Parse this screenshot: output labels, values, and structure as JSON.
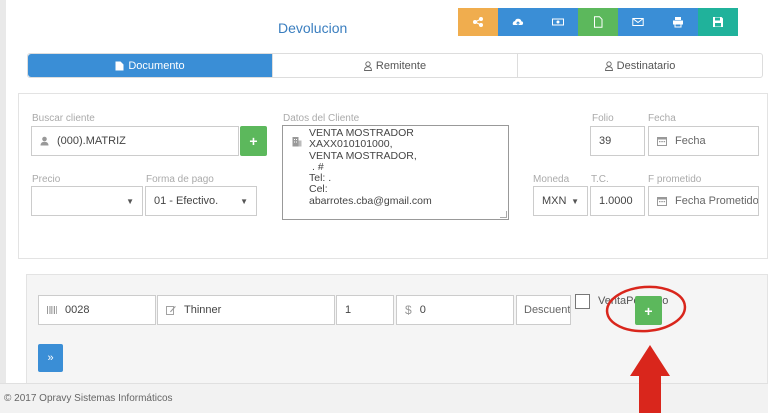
{
  "page": {
    "title": "Devolucion"
  },
  "toolbar": {
    "buttons": [
      {
        "icon": "share-nodes-icon",
        "color": "#f0ad4e"
      },
      {
        "icon": "cloud-upload-icon",
        "color": "#3a8ed6"
      },
      {
        "icon": "money-icon",
        "color": "#3a8ed6"
      },
      {
        "icon": "file-icon",
        "color": "#5cb85c"
      },
      {
        "icon": "envelope-icon",
        "color": "#3a8ed6"
      },
      {
        "icon": "print-icon",
        "color": "#3a8ed6"
      },
      {
        "icon": "save-icon",
        "color": "#20b29b"
      }
    ]
  },
  "tabs": [
    {
      "label": "Documento",
      "icon": "document-icon",
      "active": true
    },
    {
      "label": "Remitente",
      "icon": "user-icon",
      "active": false
    },
    {
      "label": "Destinatario",
      "icon": "user-icon",
      "active": false
    }
  ],
  "client": {
    "search_label": "Buscar cliente",
    "search_value": "(000).MATRIZ",
    "datos_label": "Datos del Cliente",
    "datos_lines": [
      "VENTA MOSTRADOR",
      "XAXX010101000,",
      "VENTA MOSTRADOR,",
      ". #",
      "Tel: .",
      "Cel:",
      "abarrotes.cba@gmail.com"
    ]
  },
  "folio": {
    "label": "Folio",
    "value": "39"
  },
  "fecha": {
    "label": "Fecha",
    "placeholder": "Fecha"
  },
  "precio": {
    "label": "Precio",
    "value": ""
  },
  "forma_pago": {
    "label": "Forma de pago",
    "value": "01 - Efectivo."
  },
  "moneda": {
    "label": "Moneda",
    "value": "MXN"
  },
  "tc": {
    "label": "T.C.",
    "value": "1.0000"
  },
  "f_prometido": {
    "label": "F prometido",
    "placeholder": "Fecha Prometido"
  },
  "item": {
    "code": "0028",
    "description": "Thinner",
    "quantity": "1",
    "currency_symbol": "$",
    "price": "0",
    "discount_placeholder": "Descuento",
    "checkbox_label": "VentaPorPeso"
  },
  "footer": {
    "copyright": "© 2017 Opravy Sistemas Informáticos"
  },
  "annotation": {
    "color": "#d9261c"
  }
}
